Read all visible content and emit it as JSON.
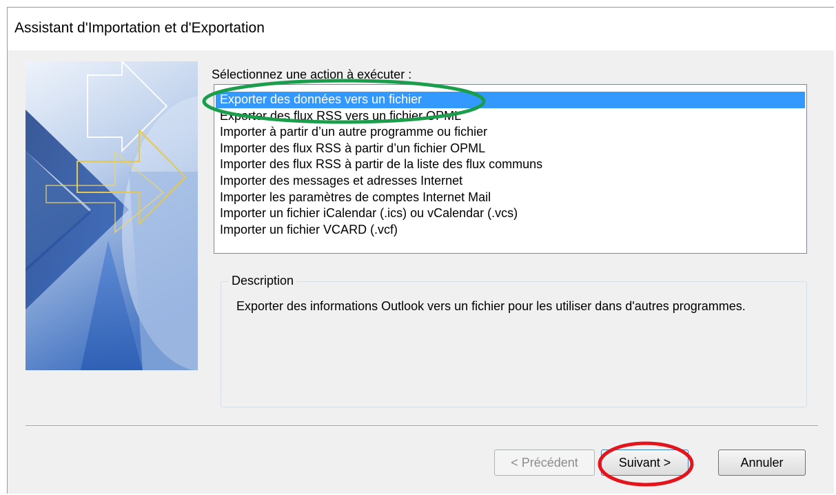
{
  "window": {
    "title": "Assistant d'Importation et d'Exportation"
  },
  "action_list": {
    "label": "Sélectionnez une action à exécuter :",
    "items": [
      "Exporter des données vers un fichier",
      "Exporter des flux RSS vers un fichier OPML",
      "Importer à partir d’un autre programme ou fichier",
      "Importer des flux RSS à partir d’un fichier OPML",
      "Importer des flux RSS à partir de la liste des flux communs",
      "Importer des messages et adresses Internet",
      "Importer les paramètres de comptes Internet Mail",
      "Importer un fichier iCalendar (.ics) ou vCalendar (.vcs)",
      "Importer un fichier VCARD (.vcf)"
    ],
    "selected_index": 0
  },
  "description": {
    "legend": "Description",
    "text": "Exporter des informations Outlook vers un fichier pour les utiliser dans d'autres programmes."
  },
  "buttons": {
    "back": "< Précédent",
    "next": "Suivant >",
    "cancel": "Annuler"
  },
  "annotations": {
    "selected_item_highlight_color": "#1a9e4b",
    "next_button_highlight_color": "#e3141b"
  },
  "colors": {
    "selection": "#3399ff",
    "dialog_bg": "#f0f0f0"
  }
}
